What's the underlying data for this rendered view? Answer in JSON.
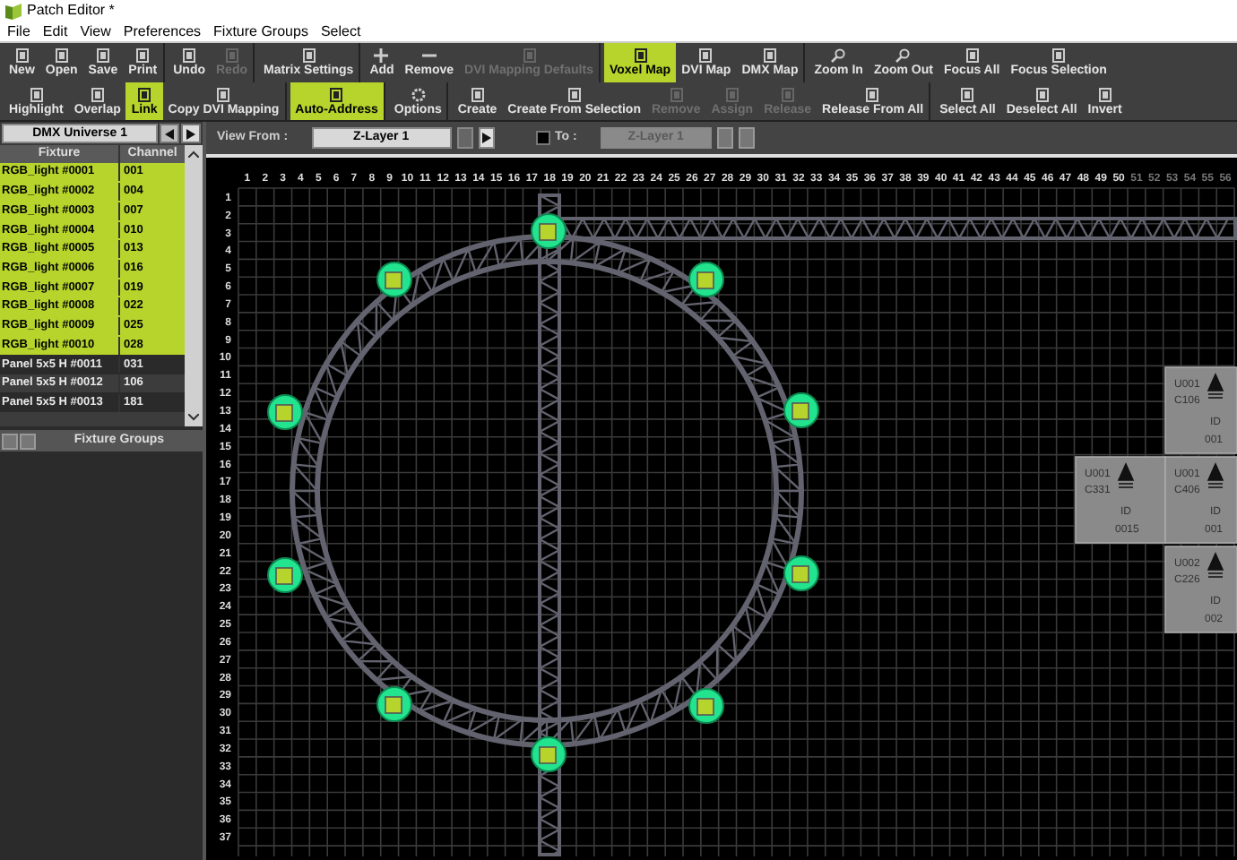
{
  "window": {
    "title": "Patch Editor *"
  },
  "menu": [
    "File",
    "Edit",
    "View",
    "Preferences",
    "Fixture Groups",
    "Select"
  ],
  "toolbar_rows": [
    [
      [
        {
          "label": "New",
          "selected": false,
          "disabled": false
        },
        {
          "label": "Open",
          "selected": false,
          "disabled": false
        },
        {
          "label": "Save",
          "selected": false,
          "disabled": false
        },
        {
          "label": "Print",
          "selected": false,
          "disabled": false
        }
      ],
      [
        {
          "label": "Undo",
          "selected": false,
          "disabled": false
        },
        {
          "label": "Redo",
          "selected": false,
          "disabled": true
        }
      ],
      [
        {
          "label": "Matrix Settings",
          "selected": false,
          "disabled": false
        }
      ],
      [
        {
          "label": "Add",
          "selected": false,
          "disabled": false
        },
        {
          "label": "Remove",
          "selected": false,
          "disabled": false
        },
        {
          "label": "DVI Mapping Defaults",
          "selected": false,
          "disabled": true
        }
      ],
      [
        {
          "label": "Voxel Map",
          "selected": true,
          "disabled": false
        },
        {
          "label": "DVI Map",
          "selected": false,
          "disabled": false
        },
        {
          "label": "DMX Map",
          "selected": false,
          "disabled": false
        }
      ],
      [
        {
          "label": "Zoom In",
          "selected": false,
          "disabled": false
        },
        {
          "label": "Zoom Out",
          "selected": false,
          "disabled": false
        },
        {
          "label": "Focus All",
          "selected": false,
          "disabled": false
        },
        {
          "label": "Focus Selection",
          "selected": false,
          "disabled": false
        }
      ]
    ],
    [
      [
        {
          "label": "Highlight",
          "selected": false,
          "disabled": false
        },
        {
          "label": "Overlap",
          "selected": false,
          "disabled": false
        },
        {
          "label": "Link",
          "selected": true,
          "disabled": false
        },
        {
          "label": "Copy DVI Mapping",
          "selected": false,
          "disabled": false
        }
      ],
      [
        {
          "label": "Auto-Address",
          "selected": true,
          "disabled": false
        }
      ],
      [
        {
          "label": "Options",
          "selected": false,
          "disabled": false
        }
      ],
      [
        {
          "label": "Create",
          "selected": false,
          "disabled": false
        },
        {
          "label": "Create From Selection",
          "selected": false,
          "disabled": false
        },
        {
          "label": "Remove",
          "selected": false,
          "disabled": true
        },
        {
          "label": "Assign",
          "selected": false,
          "disabled": true
        },
        {
          "label": "Release",
          "selected": false,
          "disabled": true
        },
        {
          "label": "Release From All",
          "selected": false,
          "disabled": false
        }
      ],
      [
        {
          "label": "Select All",
          "selected": false,
          "disabled": false
        },
        {
          "label": "Deselect All",
          "selected": false,
          "disabled": false
        },
        {
          "label": "Invert",
          "selected": false,
          "disabled": false
        }
      ]
    ]
  ],
  "universe": {
    "label": "DMX Universe 1"
  },
  "table": {
    "columns": [
      "Fixture",
      "Channel"
    ],
    "rows": [
      {
        "fixture": "RGB_light #0001",
        "channel": "001",
        "selected": true
      },
      {
        "fixture": "RGB_light #0002",
        "channel": "004",
        "selected": true
      },
      {
        "fixture": "RGB_light #0003",
        "channel": "007",
        "selected": true
      },
      {
        "fixture": "RGB_light #0004",
        "channel": "010",
        "selected": true
      },
      {
        "fixture": "RGB_light #0005",
        "channel": "013",
        "selected": true
      },
      {
        "fixture": "RGB_light #0006",
        "channel": "016",
        "selected": true
      },
      {
        "fixture": "RGB_light #0007",
        "channel": "019",
        "selected": true
      },
      {
        "fixture": "RGB_light #0008",
        "channel": "022",
        "selected": true
      },
      {
        "fixture": "RGB_light #0009",
        "channel": "025",
        "selected": true
      },
      {
        "fixture": "RGB_light #0010",
        "channel": "028",
        "selected": true
      },
      {
        "fixture": "Panel 5x5 H #0011",
        "channel": "031",
        "selected": false
      },
      {
        "fixture": "Panel 5x5 H #0012",
        "channel": "106",
        "selected": false
      },
      {
        "fixture": "Panel 5x5 H #0013",
        "channel": "181",
        "selected": false
      }
    ]
  },
  "fixture_groups": {
    "title": "Fixture Groups"
  },
  "view_bar": {
    "view_from_label": "View From :",
    "view_from": "Z-Layer 1",
    "to_enabled": false,
    "to_label": "To :",
    "to_value": "Z-Layer 1"
  },
  "canvas": {
    "column_labels": [
      "1",
      "2",
      "3",
      "4",
      "5",
      "6",
      "7",
      "8",
      "9",
      "10",
      "11",
      "12",
      "13",
      "14",
      "15",
      "16",
      "17",
      "18",
      "19",
      "20",
      "21",
      "22",
      "23",
      "24",
      "25",
      "26",
      "27",
      "28",
      "29",
      "30",
      "31",
      "32",
      "33",
      "34",
      "35",
      "36",
      "37",
      "38",
      "39",
      "40",
      "41",
      "42",
      "43",
      "44",
      "45",
      "46",
      "47",
      "48",
      "49",
      "50"
    ],
    "inactive_column_labels": [
      "51",
      "52",
      "53",
      "54",
      "55",
      "56"
    ],
    "row_labels": [
      "1",
      "2",
      "3",
      "4",
      "5",
      "6",
      "7",
      "8",
      "9",
      "10",
      "11",
      "12",
      "13",
      "14",
      "15",
      "16",
      "17",
      "18",
      "19",
      "20",
      "21",
      "22",
      "23",
      "24",
      "25",
      "26",
      "27",
      "28",
      "29",
      "30",
      "31",
      "32",
      "33",
      "34",
      "35",
      "36",
      "37"
    ],
    "lamps": [
      {
        "selected": true
      },
      {
        "selected": true
      },
      {
        "selected": true
      },
      {
        "selected": true
      },
      {
        "selected": true
      },
      {
        "selected": true
      },
      {
        "selected": true
      },
      {
        "selected": true
      },
      {
        "selected": true
      },
      {
        "selected": true
      }
    ],
    "panels": [
      {
        "universe": "U001",
        "channel": "C106",
        "id_label": "ID",
        "id": "001"
      },
      {
        "universe": "U001",
        "channel": "C331",
        "id_label": "ID",
        "id": "0015"
      },
      {
        "universe": "U001",
        "channel": "C406",
        "id_label": "ID",
        "id": "001"
      },
      {
        "universe": "U002",
        "channel": "C226",
        "id_label": "ID",
        "id": "002"
      }
    ]
  }
}
